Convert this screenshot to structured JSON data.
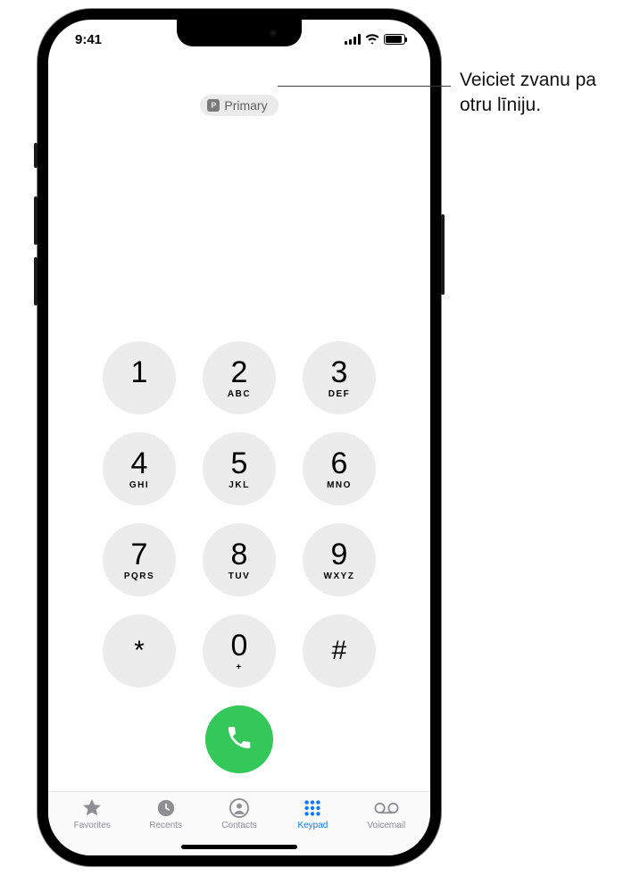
{
  "status": {
    "time": "9:41"
  },
  "sim": {
    "badge": "P",
    "label": "Primary"
  },
  "callout": {
    "text": "Veiciet zvanu pa otru līniju."
  },
  "keys": [
    {
      "digit": "1",
      "letters": ""
    },
    {
      "digit": "2",
      "letters": "ABC"
    },
    {
      "digit": "3",
      "letters": "DEF"
    },
    {
      "digit": "4",
      "letters": "GHI"
    },
    {
      "digit": "5",
      "letters": "JKL"
    },
    {
      "digit": "6",
      "letters": "MNO"
    },
    {
      "digit": "7",
      "letters": "PQRS"
    },
    {
      "digit": "8",
      "letters": "TUV"
    },
    {
      "digit": "9",
      "letters": "WXYZ"
    },
    {
      "digit": "*",
      "letters": ""
    },
    {
      "digit": "0",
      "letters": "+"
    },
    {
      "digit": "#",
      "letters": ""
    }
  ],
  "tabs": [
    {
      "id": "favorites",
      "label": "Favorites",
      "active": false
    },
    {
      "id": "recents",
      "label": "Recents",
      "active": false
    },
    {
      "id": "contacts",
      "label": "Contacts",
      "active": false
    },
    {
      "id": "keypad",
      "label": "Keypad",
      "active": true
    },
    {
      "id": "voicemail",
      "label": "Voicemail",
      "active": false
    }
  ],
  "colors": {
    "accent": "#0a7aff",
    "call": "#34c759",
    "key": "#ececec"
  }
}
